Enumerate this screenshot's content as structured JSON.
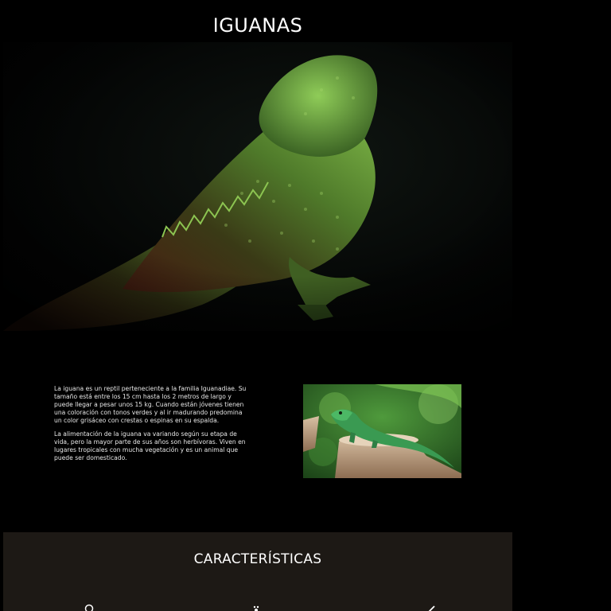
{
  "page": {
    "title": "IGUANAS"
  },
  "hero_image": {
    "alt": "iguana-hero-photo"
  },
  "intro": {
    "paragraph_1": "La iguana es un reptil perteneciente a la familia Iguanadiae. Su tamaño está entre los 15 cm hasta los 2 metros de largo y puede llegar a pesar unos 15 kg. Cuando están jóvenes tienen una coloración con tonos verdes y al ir madurando predomina un color grisáceo con crestas o espinas en su espalda.",
    "paragraph_2": "La alimentación de la iguana va variando según su etapa de vida, pero la mayor parte de sus años son herbívoras. Viven en lugares tropicales con mucha vegetación y es un animal que puede ser domesticado."
  },
  "features": {
    "title": "CARACTERÍSTICAS",
    "icons": [
      "location-icon",
      "paw-icon",
      "arrow-icon"
    ]
  },
  "colors": {
    "background": "#000000",
    "features_band": "#1d1915",
    "text": "#ffffff"
  }
}
